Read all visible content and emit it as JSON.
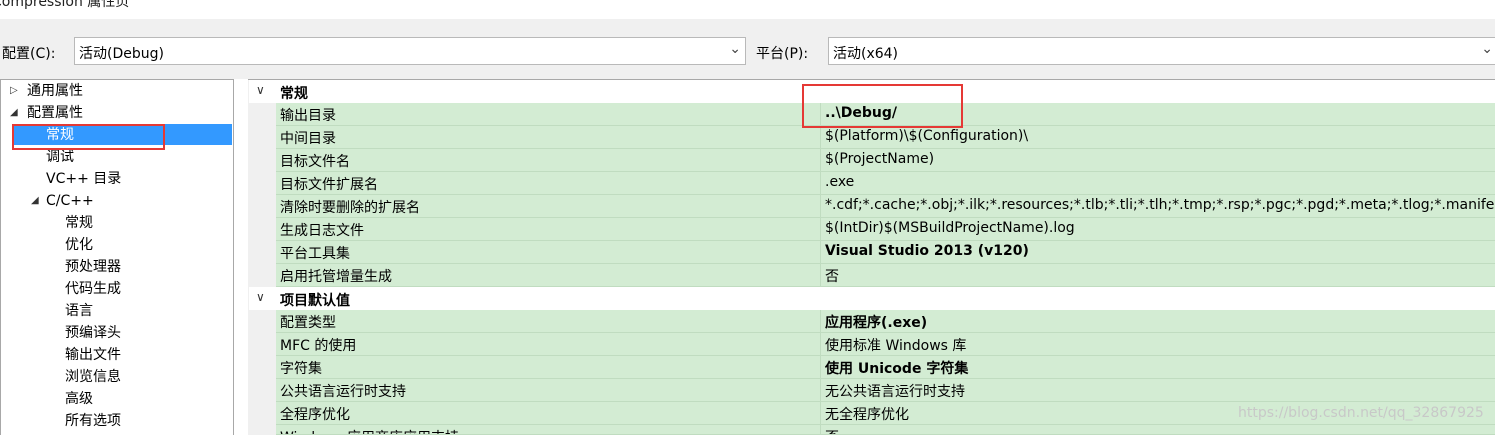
{
  "window": {
    "title": "Compression 属性页"
  },
  "toolbar": {
    "config_label": "配置(C):",
    "config_value": "活动(Debug)",
    "platform_label": "平台(P):",
    "platform_value": "活动(x64)"
  },
  "tree": {
    "items": [
      {
        "label": "通用属性"
      },
      {
        "label": "配置属性"
      },
      {
        "label": "常规"
      },
      {
        "label": "调试"
      },
      {
        "label": "VC++ 目录"
      },
      {
        "label": "C/C++"
      },
      {
        "label": "常规"
      },
      {
        "label": "优化"
      },
      {
        "label": "预处理器"
      },
      {
        "label": "代码生成"
      },
      {
        "label": "语言"
      },
      {
        "label": "预编译头"
      },
      {
        "label": "输出文件"
      },
      {
        "label": "浏览信息"
      },
      {
        "label": "高级"
      },
      {
        "label": "所有选项"
      }
    ]
  },
  "grid": {
    "categories": [
      {
        "name": "常规"
      },
      {
        "name": "项目默认值"
      }
    ],
    "rows": [
      {
        "name": "输出目录",
        "value": "..\\Debug/"
      },
      {
        "name": "中间目录",
        "value": "$(Platform)\\$(Configuration)\\"
      },
      {
        "name": "目标文件名",
        "value": "$(ProjectName)"
      },
      {
        "name": "目标文件扩展名",
        "value": ".exe"
      },
      {
        "name": "清除时要删除的扩展名",
        "value": "*.cdf;*.cache;*.obj;*.ilk;*.resources;*.tlb;*.tli;*.tlh;*.tmp;*.rsp;*.pgc;*.pgd;*.meta;*.tlog;*.manife"
      },
      {
        "name": "生成日志文件",
        "value": "$(IntDir)$(MSBuildProjectName).log"
      },
      {
        "name": "平台工具集",
        "value": "Visual Studio 2013 (v120)"
      },
      {
        "name": "启用托管增量生成",
        "value": "否"
      },
      {
        "name": "配置类型",
        "value": "应用程序(.exe)"
      },
      {
        "name": "MFC 的使用",
        "value": "使用标准 Windows 库"
      },
      {
        "name": "字符集",
        "value": "使用 Unicode 字符集"
      },
      {
        "name": "公共语言运行时支持",
        "value": "无公共语言运行时支持"
      },
      {
        "name": "全程序优化",
        "value": "无全程序优化"
      },
      {
        "name": "Windows 应用商店应用支持",
        "value": "否"
      }
    ]
  },
  "watermark": "https://blog.csdn.net/qq_32867925",
  "colors": {
    "selection": "#3399ff",
    "row_bg": "#d3ecd3",
    "highlight": "#e53935"
  }
}
